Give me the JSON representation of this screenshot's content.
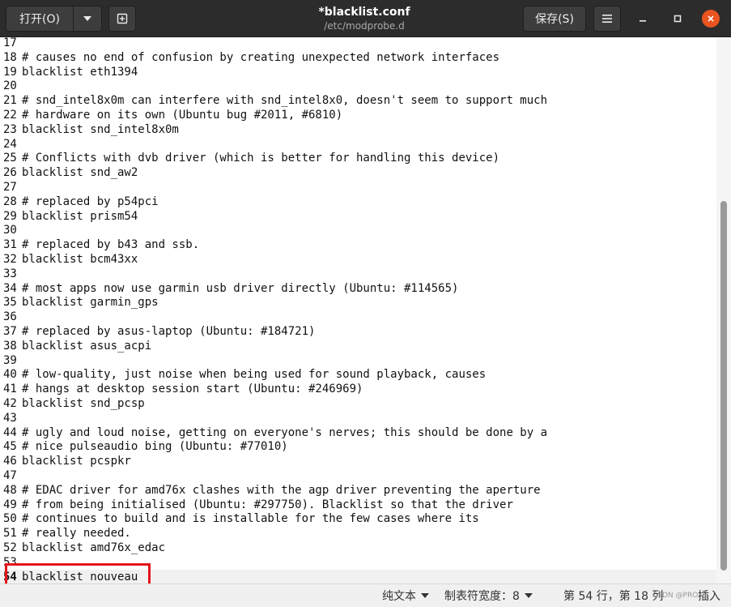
{
  "header": {
    "open_label": "打开(O)",
    "save_label": "保存(S)",
    "title": "*blacklist.conf",
    "subtitle": "/etc/modprobe.d"
  },
  "editor": {
    "current_line": 54,
    "lines": [
      {
        "n": "17",
        "t": ""
      },
      {
        "n": "18",
        "t": "# causes no end of confusion by creating unexpected network interfaces"
      },
      {
        "n": "19",
        "t": "blacklist eth1394"
      },
      {
        "n": "20",
        "t": ""
      },
      {
        "n": "21",
        "t": "# snd_intel8x0m can interfere with snd_intel8x0, doesn't seem to support much"
      },
      {
        "n": "22",
        "t": "# hardware on its own (Ubuntu bug #2011, #6810)"
      },
      {
        "n": "23",
        "t": "blacklist snd_intel8x0m"
      },
      {
        "n": "24",
        "t": ""
      },
      {
        "n": "25",
        "t": "# Conflicts with dvb driver (which is better for handling this device)"
      },
      {
        "n": "26",
        "t": "blacklist snd_aw2"
      },
      {
        "n": "27",
        "t": ""
      },
      {
        "n": "28",
        "t": "# replaced by p54pci"
      },
      {
        "n": "29",
        "t": "blacklist prism54"
      },
      {
        "n": "30",
        "t": ""
      },
      {
        "n": "31",
        "t": "# replaced by b43 and ssb."
      },
      {
        "n": "32",
        "t": "blacklist bcm43xx"
      },
      {
        "n": "33",
        "t": ""
      },
      {
        "n": "34",
        "t": "# most apps now use garmin usb driver directly (Ubuntu: #114565)"
      },
      {
        "n": "35",
        "t": "blacklist garmin_gps"
      },
      {
        "n": "36",
        "t": ""
      },
      {
        "n": "37",
        "t": "# replaced by asus-laptop (Ubuntu: #184721)"
      },
      {
        "n": "38",
        "t": "blacklist asus_acpi"
      },
      {
        "n": "39",
        "t": ""
      },
      {
        "n": "40",
        "t": "# low-quality, just noise when being used for sound playback, causes"
      },
      {
        "n": "41",
        "t": "# hangs at desktop session start (Ubuntu: #246969)"
      },
      {
        "n": "42",
        "t": "blacklist snd_pcsp"
      },
      {
        "n": "43",
        "t": ""
      },
      {
        "n": "44",
        "t": "# ugly and loud noise, getting on everyone's nerves; this should be done by a"
      },
      {
        "n": "45",
        "t": "# nice pulseaudio bing (Ubuntu: #77010)"
      },
      {
        "n": "46",
        "t": "blacklist pcspkr"
      },
      {
        "n": "47",
        "t": ""
      },
      {
        "n": "48",
        "t": "# EDAC driver for amd76x clashes with the agp driver preventing the aperture"
      },
      {
        "n": "49",
        "t": "# from being initialised (Ubuntu: #297750). Blacklist so that the driver"
      },
      {
        "n": "50",
        "t": "# continues to build and is installable for the few cases where its"
      },
      {
        "n": "51",
        "t": "# really needed."
      },
      {
        "n": "52",
        "t": "blacklist amd76x_edac"
      },
      {
        "n": "53",
        "t": ""
      },
      {
        "n": "54",
        "t": "blacklist nouveau"
      }
    ]
  },
  "statusbar": {
    "language": "纯文本",
    "tab_width": "制表符宽度：8",
    "position": "第 54 行，第 18 列",
    "insert_mode": "插入",
    "watermark": "CSDN @PRO"
  },
  "icons": {
    "open_menu": "chevron-down-icon",
    "new_tab": "new-document-icon",
    "menu": "hamburger-menu-icon",
    "minimize": "minimize-icon",
    "maximize": "maximize-icon",
    "close": "close-icon"
  },
  "colors": {
    "header_bg": "#2c2c2c",
    "close_button": "#e95420",
    "highlight_box": "#e4151b"
  }
}
